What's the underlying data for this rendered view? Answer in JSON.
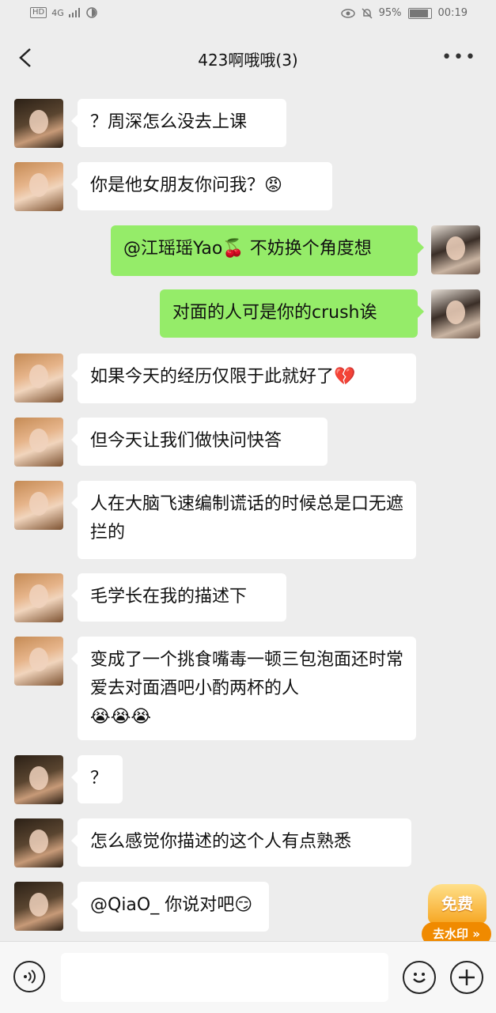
{
  "status_bar": {
    "left_chips": [
      "HD",
      "4G"
    ],
    "battery_text": "95%",
    "time": "00:19"
  },
  "header": {
    "title": "423啊哦哦(3)",
    "back_icon": "chevron-left-icon",
    "more_icon": "ellipsis-icon"
  },
  "messages": [
    {
      "side": "left",
      "avatar": "a",
      "text": "？周深怎么没去上课"
    },
    {
      "side": "left",
      "avatar": "b",
      "text": "你是他女朋友你问我？",
      "emoji": "😡"
    },
    {
      "side": "right",
      "avatar": "me",
      "text": "@江瑶瑶Yao🍒 不妨换个角度想"
    },
    {
      "side": "right",
      "avatar": "me",
      "text": "对面的人可是你的crush诶"
    },
    {
      "side": "left",
      "avatar": "b",
      "text": "如果今天的经历仅限于此就好了",
      "emoji": "💔"
    },
    {
      "side": "left",
      "avatar": "b",
      "text": "但今天让我们做快问快答"
    },
    {
      "side": "left",
      "avatar": "b",
      "text": "人在大脑飞速编制谎话的时候总是口无遮拦的"
    },
    {
      "side": "left",
      "avatar": "b",
      "text": "毛学长在我的描述下"
    },
    {
      "side": "left",
      "avatar": "b",
      "text": "变成了一个挑食嘴毒一顿三包泡面还时常爱去对面酒吧小酌两杯的人",
      "emoji": "😭😭😭"
    },
    {
      "side": "left",
      "avatar": "a",
      "text": "？"
    },
    {
      "side": "left",
      "avatar": "a",
      "text": "怎么感觉你描述的这个人有点熟悉"
    },
    {
      "side": "left",
      "avatar": "a",
      "text": "@QiaO_ 你说对吧",
      "emoji": "😏"
    }
  ],
  "promo": {
    "top": "免费",
    "bottom": "去水印 »"
  },
  "input_bar": {
    "voice_icon": "voice-icon",
    "placeholder": "",
    "emoji_icon": "smile-icon",
    "plus_icon": "plus-icon"
  }
}
